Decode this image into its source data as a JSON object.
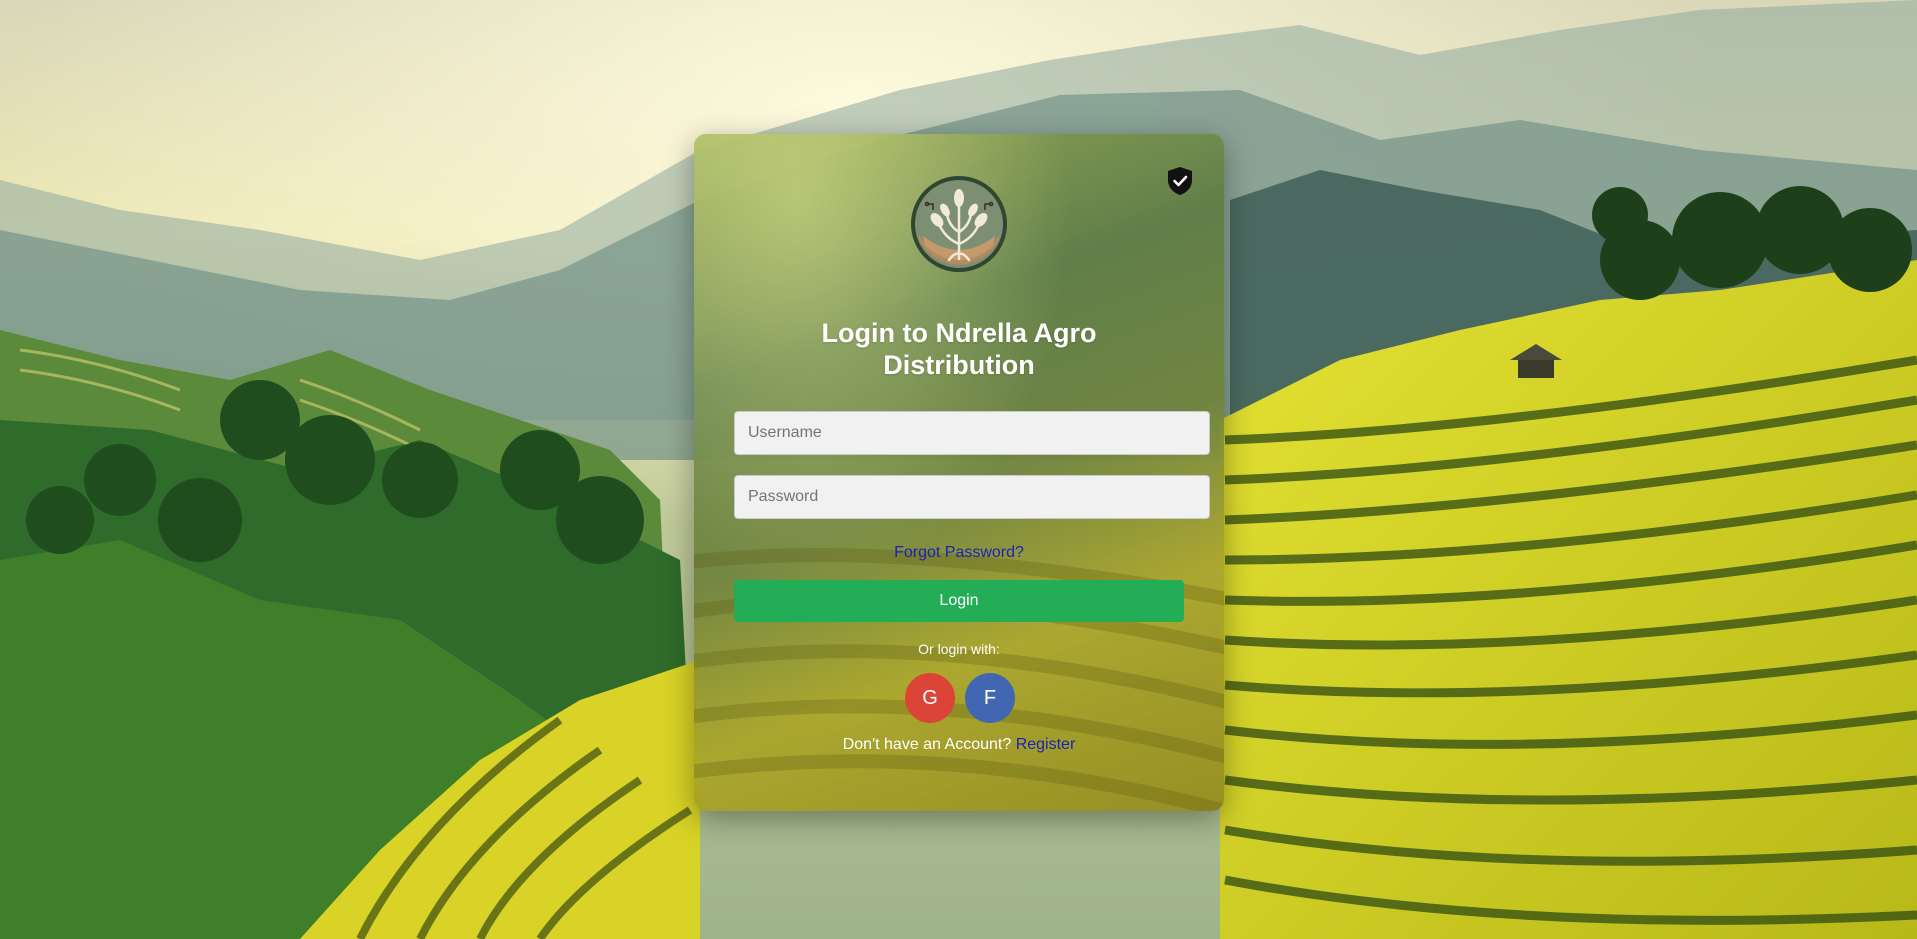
{
  "login": {
    "title_line1": "Login to Ndrella Agro",
    "title_line2": "Distribution",
    "username_placeholder": "Username",
    "password_placeholder": "Password",
    "forgot_password": "Forgot Password?",
    "login_button": "Login",
    "or_login_with": "Or login with:",
    "google_label": "G",
    "facebook_label": "F",
    "no_account_text": "Don't have an Account?",
    "register_link": "Register"
  },
  "icons": {
    "logo": "plant-logo-icon",
    "security": "shield-check-icon"
  },
  "colors": {
    "login_button": "#23ad57",
    "google": "#db4437",
    "facebook": "#4267b2",
    "link": "#1a22b8"
  }
}
